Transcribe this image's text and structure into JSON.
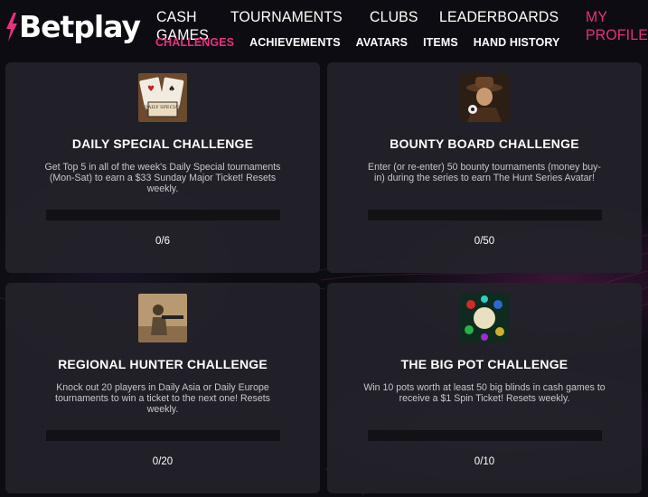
{
  "brand": {
    "logo_text": "Betplay",
    "accent_color": "#e8317f"
  },
  "nav": {
    "main": [
      {
        "label": "CASH GAMES",
        "active": false
      },
      {
        "label": "TOURNAMENTS",
        "active": false
      },
      {
        "label": "CLUBS",
        "active": false
      },
      {
        "label": "LEADERBOARDS",
        "active": false
      },
      {
        "label": "MY PROFILE",
        "active": true
      }
    ],
    "sub": [
      {
        "label": "CHALLENGES",
        "active": true
      },
      {
        "label": "ACHIEVEMENTS",
        "active": false
      },
      {
        "label": "AVATARS",
        "active": false
      },
      {
        "label": "ITEMS",
        "active": false
      },
      {
        "label": "HAND HISTORY",
        "active": false
      }
    ]
  },
  "challenges": [
    {
      "title": "DAILY SPECIAL CHALLENGE",
      "description": "Get Top 5 in all of the week's Daily Special tournaments (Mon-Sat) to earn a $33 Sunday Major Ticket! Resets weekly.",
      "progress_text": "0/6",
      "progress": 0,
      "image_label": "DAILY SPECIAL",
      "image_icon": "playing-cards-icon"
    },
    {
      "title": "BOUNTY BOARD CHALLENGE",
      "description": "Enter (or re-enter) 50 bounty tournaments (money buy-in) during the series to earn The Hunt Series Avatar!",
      "progress_text": "0/50",
      "progress": 0,
      "image_icon": "cowboy-avatar-icon"
    },
    {
      "title": "REGIONAL HUNTER CHALLENGE",
      "description": "Knock out 20 players in Daily Asia or Daily Europe tournaments to win a ticket to the next one! Resets weekly.",
      "progress_text": "0/20",
      "progress": 0,
      "image_icon": "soldier-icon"
    },
    {
      "title": "THE BIG POT CHALLENGE",
      "description": "Win 10 pots worth at least 50 big blinds in cash games to receive a $1 Spin Ticket! Resets weekly.",
      "progress_text": "0/10",
      "progress": 0,
      "image_icon": "poker-chips-icon"
    }
  ]
}
